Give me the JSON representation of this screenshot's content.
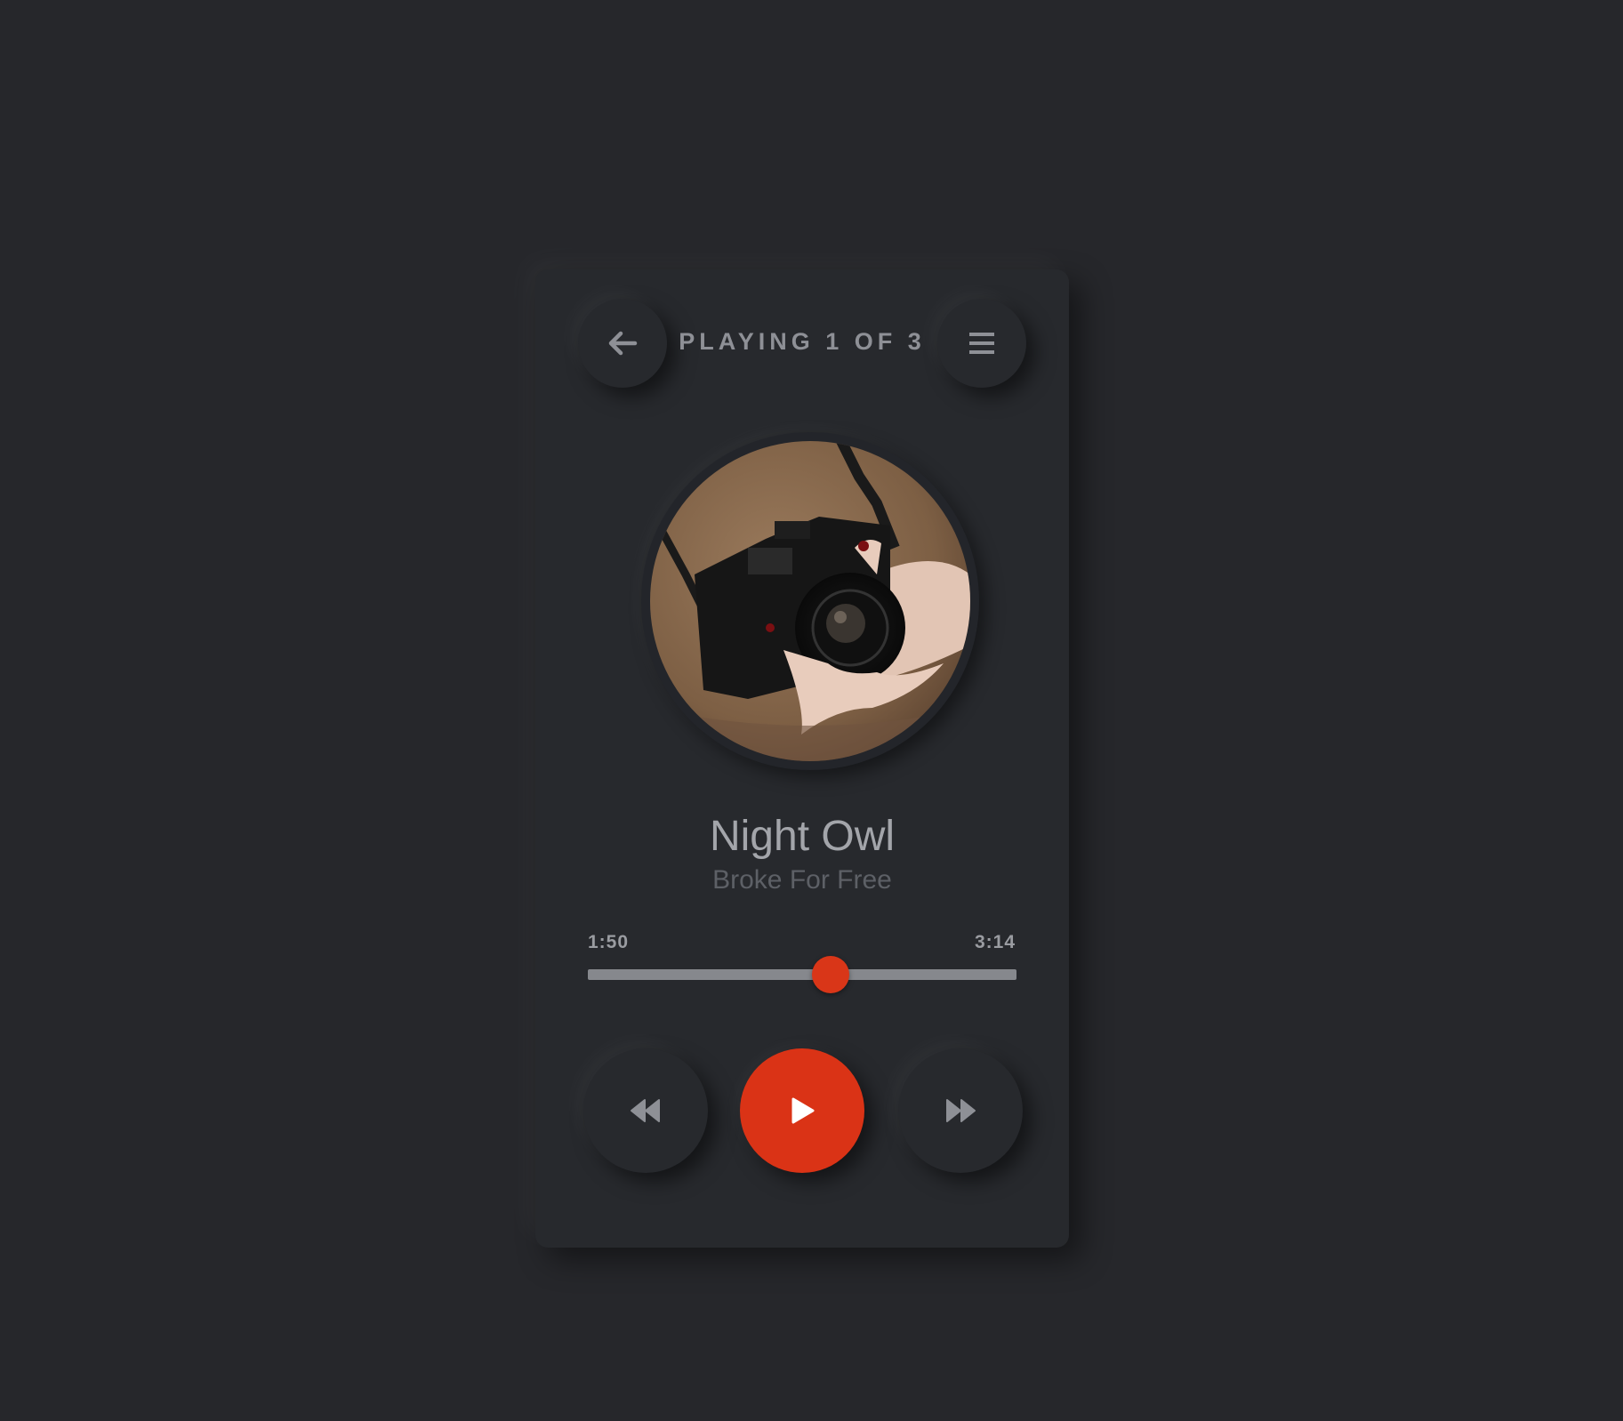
{
  "header": {
    "title": "PLAYING 1 OF 3",
    "back_icon": "arrow-left-icon",
    "menu_icon": "hamburger-menu-icon"
  },
  "album_art": {
    "description_icon": "album-art-image"
  },
  "track": {
    "title": "Night Owl",
    "artist": "Broke For Free"
  },
  "progress": {
    "elapsed": "1:50",
    "total": "3:14",
    "fraction": 0.567
  },
  "controls": {
    "rewind_icon": "rewind-icon",
    "play_icon": "play-icon",
    "forward_icon": "fast-forward-icon"
  },
  "colors": {
    "background": "#26272b",
    "card": "#27292d",
    "accent": "#da3316",
    "text_primary": "#a3a5aa",
    "text_secondary": "#5d6066"
  }
}
